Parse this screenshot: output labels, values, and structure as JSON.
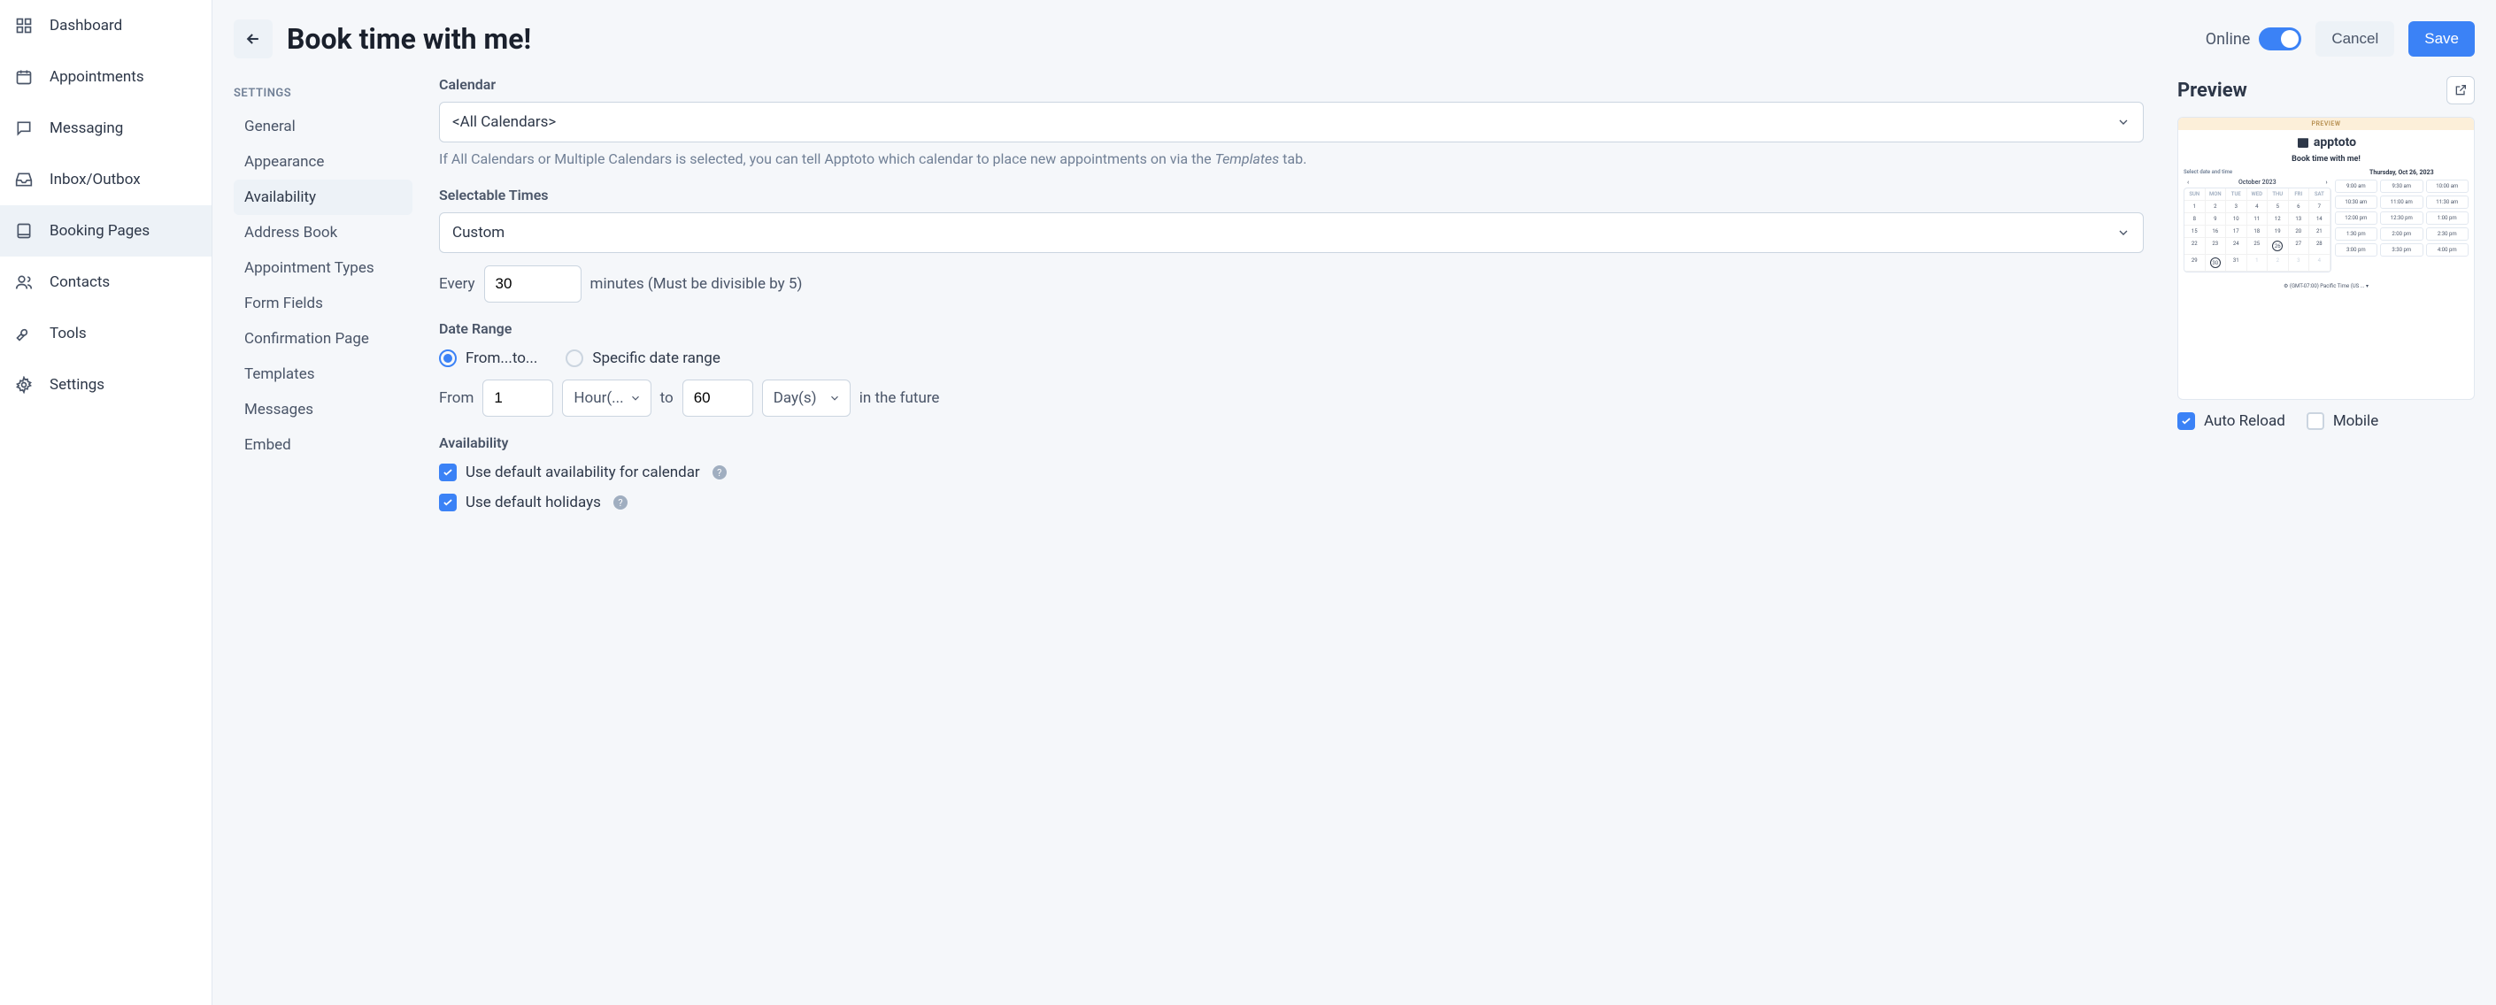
{
  "nav": {
    "items": [
      {
        "label": "Dashboard",
        "icon": "grid-icon"
      },
      {
        "label": "Appointments",
        "icon": "calendar-icon"
      },
      {
        "label": "Messaging",
        "icon": "chat-icon"
      },
      {
        "label": "Inbox/Outbox",
        "icon": "inbox-icon"
      },
      {
        "label": "Booking Pages",
        "icon": "tablet-icon"
      },
      {
        "label": "Contacts",
        "icon": "users-icon"
      },
      {
        "label": "Tools",
        "icon": "wrench-icon"
      },
      {
        "label": "Settings",
        "icon": "gear-icon"
      }
    ],
    "activeIndex": 4
  },
  "header": {
    "back": "←",
    "title": "Book time with me!",
    "online_label": "Online",
    "online": true,
    "cancel": "Cancel",
    "save": "Save"
  },
  "settings_nav": {
    "heading": "SETTINGS",
    "items": [
      "General",
      "Appearance",
      "Availability",
      "Address Book",
      "Appointment Types",
      "Form Fields",
      "Confirmation Page",
      "Templates",
      "Messages",
      "Embed"
    ],
    "activeIndex": 2
  },
  "form": {
    "calendar": {
      "label": "Calendar",
      "value": "<All Calendars>",
      "help_pre": "If All Calendars or Multiple Calendars is selected, you can tell Apptoto which calendar to place new appointments on via the ",
      "help_em": "Templates",
      "help_post": " tab."
    },
    "selectable": {
      "label": "Selectable Times",
      "value": "Custom",
      "every_pre": "Every",
      "every_value": "30",
      "every_post": "minutes (Must be divisible by 5)"
    },
    "date_range": {
      "label": "Date Range",
      "opt_fromto": "From...to...",
      "opt_specific": "Specific date range",
      "selected": "fromto",
      "from_label": "From",
      "from_value": "1",
      "from_unit": "Hour(...",
      "to_label": "to",
      "to_value": "60",
      "to_unit": "Day(s)",
      "future_text": "in the future"
    },
    "availability": {
      "label": "Availability",
      "default_cal": "Use default availability for calendar",
      "default_cal_checked": true,
      "default_hol": "Use default holidays",
      "default_hol_checked": true
    }
  },
  "preview": {
    "title": "Preview",
    "banner": "PREVIEW",
    "brand": "apptoto",
    "page_title": "Book time with me!",
    "select_label": "Select date and time",
    "date_header": "Thursday, Oct 26, 2023",
    "month": "October 2023",
    "weekdays": [
      "SUN",
      "MON",
      "TUE",
      "WED",
      "THU",
      "FRI",
      "SAT"
    ],
    "days": [
      [
        "1",
        "2",
        "3",
        "4",
        "5",
        "6",
        "7"
      ],
      [
        "8",
        "9",
        "10",
        "11",
        "12",
        "13",
        "14"
      ],
      [
        "15",
        "16",
        "17",
        "18",
        "19",
        "20",
        "21"
      ],
      [
        "22",
        "23",
        "24",
        "25",
        "26",
        "27",
        "28"
      ],
      [
        "29",
        "30",
        "31",
        "1",
        "2",
        "3",
        "4"
      ]
    ],
    "today": "30",
    "picked": "26",
    "times": [
      "9:00 am",
      "9:30 am",
      "10:00 am",
      "10:30 am",
      "11:00 am",
      "11:30 am",
      "12:00 pm",
      "12:30 pm",
      "1:00 pm",
      "1:30 pm",
      "2:00 pm",
      "2:30 pm",
      "3:00 pm",
      "3:30 pm",
      "4:00 pm"
    ],
    "timezone": "(GMT-07:00) Pacific Time (US ...",
    "auto_reload": "Auto Reload",
    "auto_reload_checked": true,
    "mobile": "Mobile",
    "mobile_checked": false
  }
}
